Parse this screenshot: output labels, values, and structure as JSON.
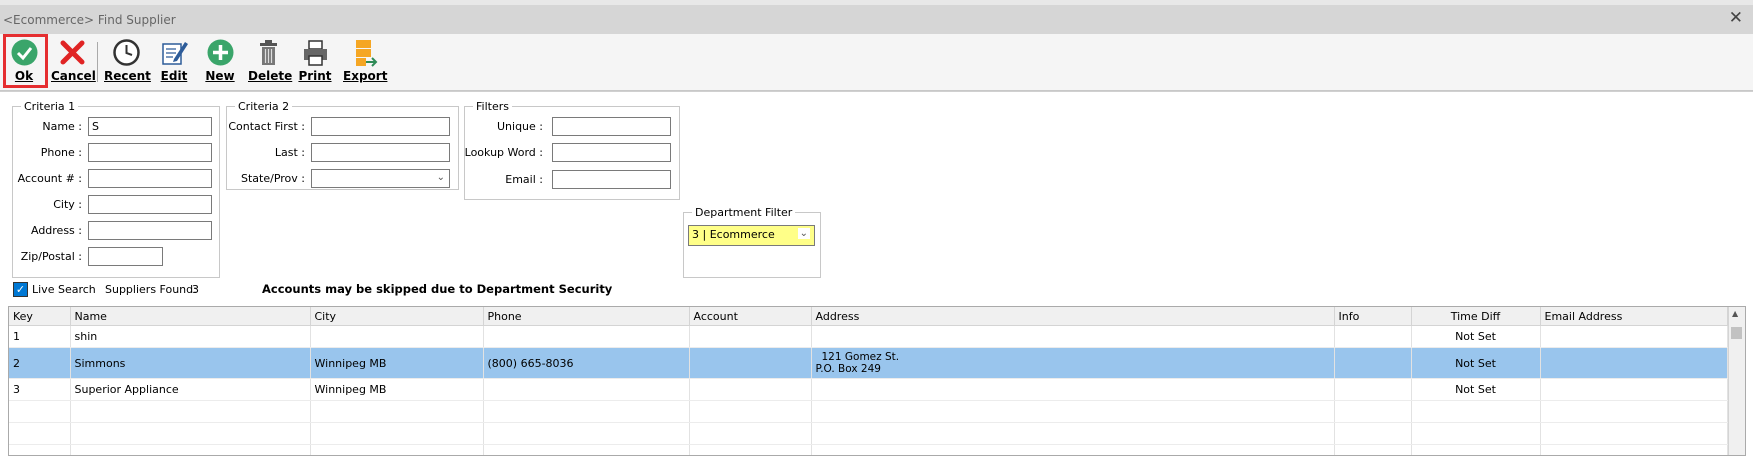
{
  "window": {
    "title": "<Ecommerce> Find Supplier",
    "close": "✕"
  },
  "toolbar": {
    "ok": "Ok",
    "cancel": "Cancel",
    "recent": "Recent",
    "edit": "Edit",
    "new": "New",
    "delete": "Delete",
    "print": "Print",
    "export": "Export"
  },
  "criteria1": {
    "legend": "Criteria 1",
    "name_label": "Name :",
    "name_value": "S",
    "phone_label": "Phone :",
    "account_label": "Account # :",
    "city_label": "City :",
    "address_label": "Address :",
    "zip_label": "Zip/Postal :"
  },
  "criteria2": {
    "legend": "Criteria 2",
    "contact_first_label": "Contact First :",
    "last_label": "Last :",
    "state_label": "State/Prov :"
  },
  "filters": {
    "legend": "Filters",
    "unique_label": "Unique :",
    "lookup_label": "Lookup Word :",
    "email_label": "Email :"
  },
  "department": {
    "legend": "Department Filter",
    "value": "3 | Ecommerce"
  },
  "live_search": {
    "label": "Live Search",
    "checked": true,
    "check": "✓"
  },
  "suppliers_found": {
    "label": "Suppliers Found:",
    "count": "3"
  },
  "security_notice": "Accounts may be skipped due to Department Security",
  "grid": {
    "columns": [
      "Key",
      "Name",
      "City",
      "Phone",
      "Account",
      "Address",
      "Info",
      "Time Diff",
      "Email Address"
    ],
    "rows": [
      {
        "key": "1",
        "name": "shin",
        "city": "",
        "phone": "",
        "account": "",
        "address1": "",
        "address2": "",
        "info": "",
        "time_diff": "Not Set",
        "email": ""
      },
      {
        "key": "2",
        "name": "Simmons",
        "city": "Winnipeg MB",
        "phone": "(800) 665-8036",
        "account": "",
        "address1": "121 Gomez St.",
        "address2": "P.O. Box 249",
        "info": "",
        "time_diff": "Not Set",
        "email": ""
      },
      {
        "key": "3",
        "name": "Superior Appliance",
        "city": "Winnipeg MB",
        "phone": "",
        "account": "",
        "address1": "",
        "address2": "",
        "info": "",
        "time_diff": "Not Set",
        "email": ""
      }
    ]
  }
}
